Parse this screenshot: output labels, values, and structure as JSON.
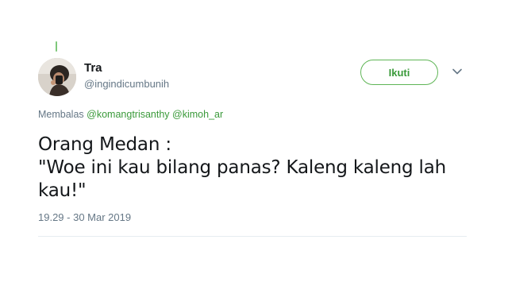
{
  "user": {
    "display_name": "Tra",
    "handle": "@ingindicumbunih"
  },
  "follow_button": {
    "label": "Ikuti"
  },
  "reply": {
    "prefix": "Membalas",
    "mentions": [
      "@komangtrisanthy",
      "@kimoh_ar"
    ]
  },
  "tweet": {
    "lines": [
      "Orang Medan :",
      "\"Woe ini kau bilang panas? Kaleng kaleng lah",
      "kau!\""
    ],
    "timestamp": "19.29 - 30 Mar 2019"
  },
  "icons": {
    "avatar": "profile-photo",
    "caret": "chevron-down-icon"
  },
  "colors": {
    "accent": "#3a9a3a",
    "secondary_text": "#657786",
    "primary_text": "#14171a"
  }
}
